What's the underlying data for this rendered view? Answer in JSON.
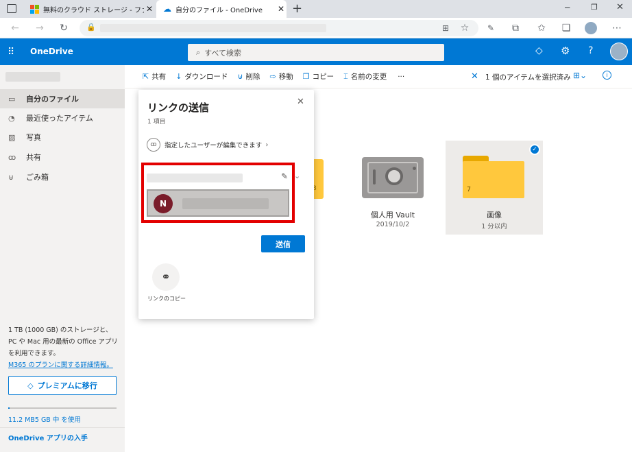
{
  "browser": {
    "tabs": [
      {
        "label": "無料のクラウド ストレージ - ファイル共"
      },
      {
        "label": "自分のファイル - OneDrive"
      }
    ]
  },
  "header": {
    "app_name": "OneDrive",
    "search_placeholder": "すべて検索"
  },
  "sidebar": {
    "items": [
      {
        "label": "自分のファイル",
        "icon": "folder-icon"
      },
      {
        "label": "最近使ったアイテム",
        "icon": "clock-icon"
      },
      {
        "label": "写真",
        "icon": "photo-icon"
      },
      {
        "label": "共有",
        "icon": "people-icon"
      },
      {
        "label": "ごみ箱",
        "icon": "trash-icon"
      }
    ],
    "storage_info": "1 TB (1000 GB) のストレージと、PC や Mac 用の最新の Office アプリを利用できます。",
    "plan_link": "M365 のプランに関する詳細情報。",
    "premium_button": "プレミアムに移行",
    "usage_text": "11.2 MB5 GB 中 を使用",
    "get_app": "OneDrive アプリの入手"
  },
  "commands": {
    "share": "共有",
    "download": "ダウンロード",
    "delete": "削除",
    "move": "移動",
    "copy": "コピー",
    "rename": "名前の変更",
    "more": "···",
    "selected": "1 個のアイテムを選択済み"
  },
  "files": [
    {
      "name": "個人用 Vault",
      "date": "2019/10/2"
    },
    {
      "name": "画像",
      "date": "1 分以内",
      "count": "7"
    }
  ],
  "dialog": {
    "title": "リンクの送信",
    "subtitle": "1 項目",
    "permission": "指定したユーザーが編集できます",
    "avatar_initial": "N",
    "send_button": "送信",
    "copy_link_label": "リンクのコピー",
    "hidden_folder_digit": "8"
  },
  "colors": {
    "brand": "#0078d4",
    "highlight": "#e30000",
    "avatar": "#7a1c2a",
    "folder": "#ffc83d"
  }
}
